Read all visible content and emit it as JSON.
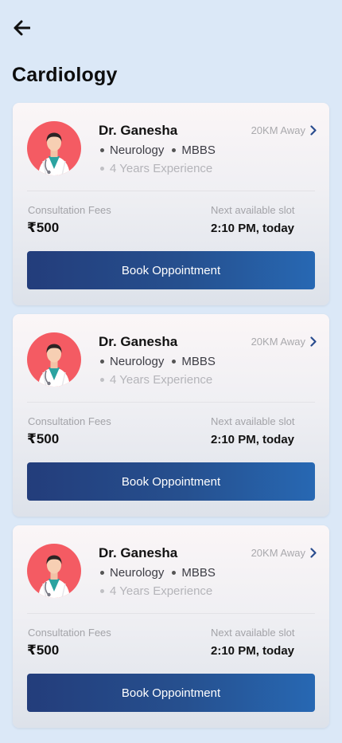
{
  "page": {
    "title": "Cardiology",
    "back_icon": "arrow-left-icon"
  },
  "doctors": [
    {
      "name": "Dr. Ganesha",
      "distance": "20KM Away",
      "specialty": "Neurology",
      "degree": "MBBS",
      "experience": "4 Years Experience",
      "fee_label": "Consultation Fees",
      "fee": "₹500",
      "slot_label": "Next available slot",
      "slot": "2:10 PM, today",
      "button_label": "Book Oppointment"
    },
    {
      "name": "Dr. Ganesha",
      "distance": "20KM Away",
      "specialty": "Neurology",
      "degree": "MBBS",
      "experience": "4 Years Experience",
      "fee_label": "Consultation Fees",
      "fee": "₹500",
      "slot_label": "Next available slot",
      "slot": "2:10 PM, today",
      "button_label": "Book Oppointment"
    },
    {
      "name": "Dr. Ganesha",
      "distance": "20KM Away",
      "specialty": "Neurology",
      "degree": "MBBS",
      "experience": "4 Years Experience",
      "fee_label": "Consultation Fees",
      "fee": "₹500",
      "slot_label": "Next available slot",
      "slot": "2:10 PM, today",
      "button_label": "Book Oppointment"
    }
  ],
  "colors": {
    "background": "#dbe8f7",
    "avatar_bg": "#f45b63",
    "button_start": "#233d7b",
    "button_end": "#2768b3",
    "chevron": "#2a4d8f"
  }
}
